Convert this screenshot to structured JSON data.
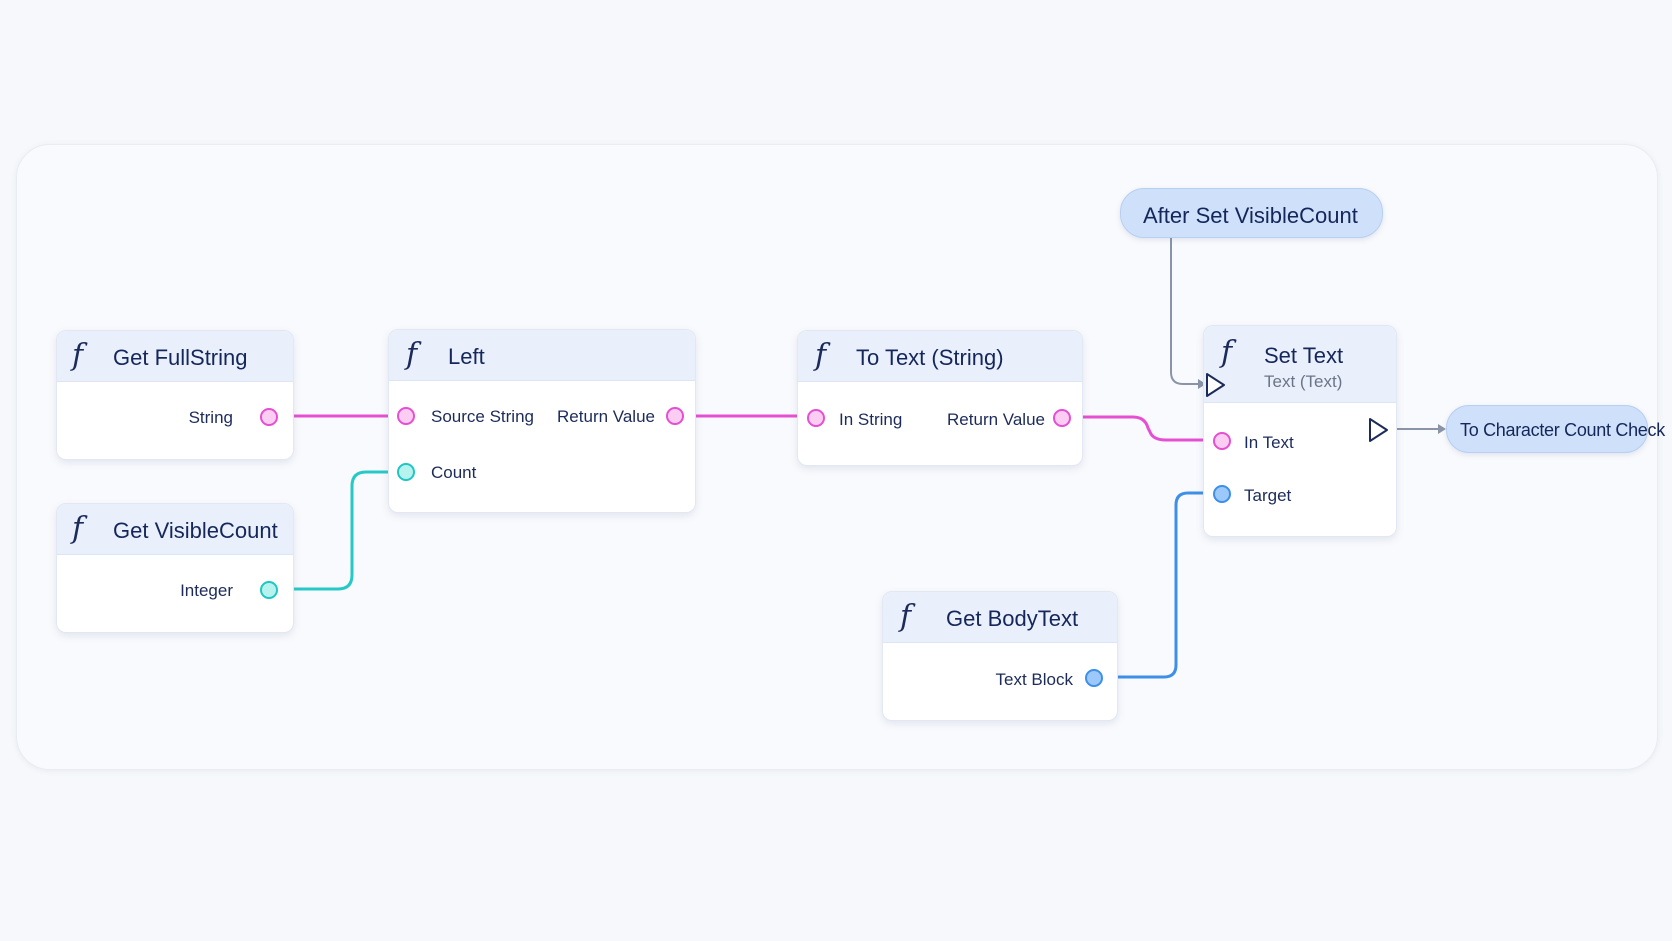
{
  "event_after": {
    "label": "After Set VisibleCount"
  },
  "event_next": {
    "label": "To Character Count Check"
  },
  "nodes": {
    "get_fullstring": {
      "icon": "function-icon",
      "title": "Get FullString",
      "outputs": [
        "String"
      ]
    },
    "get_visiblecount": {
      "icon": "function-icon",
      "title": "Get VisibleCount",
      "outputs": [
        "Integer"
      ]
    },
    "left": {
      "icon": "function-icon",
      "title": "Left",
      "inputs": [
        "Source String",
        "Count"
      ],
      "outputs": [
        "Return Value"
      ]
    },
    "to_text": {
      "icon": "function-icon",
      "title": "To Text (String)",
      "inputs": [
        "In String"
      ],
      "outputs": [
        "Return Value"
      ]
    },
    "set_text": {
      "icon": "function-icon",
      "title": "Set Text",
      "subtitle": "Text (Text)",
      "inputs": [
        "In Text",
        "Target"
      ]
    },
    "get_bodytext": {
      "icon": "function-icon",
      "title": "Get BodyText",
      "outputs": [
        "Text Block"
      ]
    }
  },
  "colors": {
    "string_wire": "#e64fd2",
    "integer_wire": "#26c9c6",
    "object_wire": "#3d8fe8",
    "exec_wire": "#8a94a6",
    "header_bg": "#e9f0fc",
    "event_bg": "#cfe1fa"
  }
}
